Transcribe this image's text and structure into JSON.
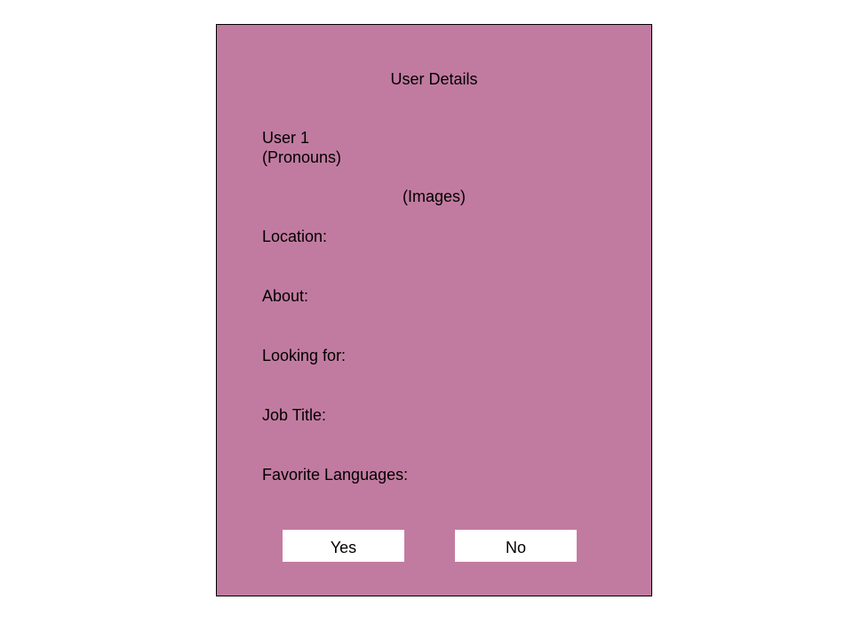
{
  "colors": {
    "card_background": "#c27ba0",
    "card_border": "#000000",
    "button_background": "#ffffff"
  },
  "card": {
    "title": "User Details",
    "user_name": "User 1",
    "pronouns": "(Pronouns)",
    "images_placeholder": "(Images)",
    "fields": {
      "location": "Location:",
      "about": "About:",
      "looking_for": "Looking for:",
      "job_title": "Job Title:",
      "favorite_languages": "Favorite Languages:"
    },
    "buttons": {
      "yes": "Yes",
      "no": "No"
    }
  }
}
